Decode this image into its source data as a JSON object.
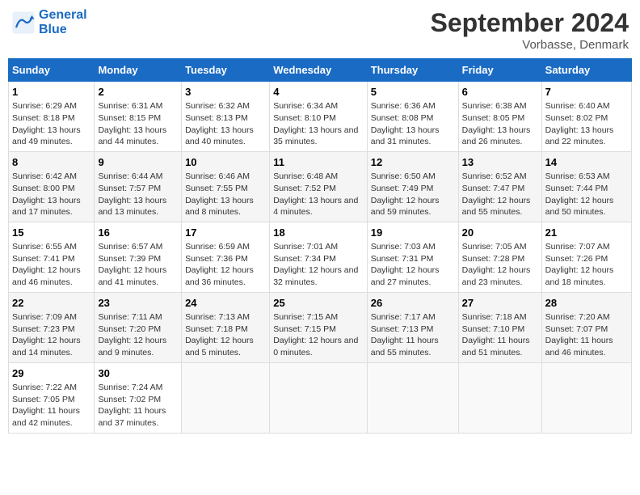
{
  "header": {
    "logo_line1": "General",
    "logo_line2": "Blue",
    "main_title": "September 2024",
    "subtitle": "Vorbasse, Denmark"
  },
  "days_of_week": [
    "Sunday",
    "Monday",
    "Tuesday",
    "Wednesday",
    "Thursday",
    "Friday",
    "Saturday"
  ],
  "weeks": [
    [
      {
        "day": "1",
        "sunrise": "Sunrise: 6:29 AM",
        "sunset": "Sunset: 8:18 PM",
        "daylight": "Daylight: 13 hours and 49 minutes."
      },
      {
        "day": "2",
        "sunrise": "Sunrise: 6:31 AM",
        "sunset": "Sunset: 8:15 PM",
        "daylight": "Daylight: 13 hours and 44 minutes."
      },
      {
        "day": "3",
        "sunrise": "Sunrise: 6:32 AM",
        "sunset": "Sunset: 8:13 PM",
        "daylight": "Daylight: 13 hours and 40 minutes."
      },
      {
        "day": "4",
        "sunrise": "Sunrise: 6:34 AM",
        "sunset": "Sunset: 8:10 PM",
        "daylight": "Daylight: 13 hours and 35 minutes."
      },
      {
        "day": "5",
        "sunrise": "Sunrise: 6:36 AM",
        "sunset": "Sunset: 8:08 PM",
        "daylight": "Daylight: 13 hours and 31 minutes."
      },
      {
        "day": "6",
        "sunrise": "Sunrise: 6:38 AM",
        "sunset": "Sunset: 8:05 PM",
        "daylight": "Daylight: 13 hours and 26 minutes."
      },
      {
        "day": "7",
        "sunrise": "Sunrise: 6:40 AM",
        "sunset": "Sunset: 8:02 PM",
        "daylight": "Daylight: 13 hours and 22 minutes."
      }
    ],
    [
      {
        "day": "8",
        "sunrise": "Sunrise: 6:42 AM",
        "sunset": "Sunset: 8:00 PM",
        "daylight": "Daylight: 13 hours and 17 minutes."
      },
      {
        "day": "9",
        "sunrise": "Sunrise: 6:44 AM",
        "sunset": "Sunset: 7:57 PM",
        "daylight": "Daylight: 13 hours and 13 minutes."
      },
      {
        "day": "10",
        "sunrise": "Sunrise: 6:46 AM",
        "sunset": "Sunset: 7:55 PM",
        "daylight": "Daylight: 13 hours and 8 minutes."
      },
      {
        "day": "11",
        "sunrise": "Sunrise: 6:48 AM",
        "sunset": "Sunset: 7:52 PM",
        "daylight": "Daylight: 13 hours and 4 minutes."
      },
      {
        "day": "12",
        "sunrise": "Sunrise: 6:50 AM",
        "sunset": "Sunset: 7:49 PM",
        "daylight": "Daylight: 12 hours and 59 minutes."
      },
      {
        "day": "13",
        "sunrise": "Sunrise: 6:52 AM",
        "sunset": "Sunset: 7:47 PM",
        "daylight": "Daylight: 12 hours and 55 minutes."
      },
      {
        "day": "14",
        "sunrise": "Sunrise: 6:53 AM",
        "sunset": "Sunset: 7:44 PM",
        "daylight": "Daylight: 12 hours and 50 minutes."
      }
    ],
    [
      {
        "day": "15",
        "sunrise": "Sunrise: 6:55 AM",
        "sunset": "Sunset: 7:41 PM",
        "daylight": "Daylight: 12 hours and 46 minutes."
      },
      {
        "day": "16",
        "sunrise": "Sunrise: 6:57 AM",
        "sunset": "Sunset: 7:39 PM",
        "daylight": "Daylight: 12 hours and 41 minutes."
      },
      {
        "day": "17",
        "sunrise": "Sunrise: 6:59 AM",
        "sunset": "Sunset: 7:36 PM",
        "daylight": "Daylight: 12 hours and 36 minutes."
      },
      {
        "day": "18",
        "sunrise": "Sunrise: 7:01 AM",
        "sunset": "Sunset: 7:34 PM",
        "daylight": "Daylight: 12 hours and 32 minutes."
      },
      {
        "day": "19",
        "sunrise": "Sunrise: 7:03 AM",
        "sunset": "Sunset: 7:31 PM",
        "daylight": "Daylight: 12 hours and 27 minutes."
      },
      {
        "day": "20",
        "sunrise": "Sunrise: 7:05 AM",
        "sunset": "Sunset: 7:28 PM",
        "daylight": "Daylight: 12 hours and 23 minutes."
      },
      {
        "day": "21",
        "sunrise": "Sunrise: 7:07 AM",
        "sunset": "Sunset: 7:26 PM",
        "daylight": "Daylight: 12 hours and 18 minutes."
      }
    ],
    [
      {
        "day": "22",
        "sunrise": "Sunrise: 7:09 AM",
        "sunset": "Sunset: 7:23 PM",
        "daylight": "Daylight: 12 hours and 14 minutes."
      },
      {
        "day": "23",
        "sunrise": "Sunrise: 7:11 AM",
        "sunset": "Sunset: 7:20 PM",
        "daylight": "Daylight: 12 hours and 9 minutes."
      },
      {
        "day": "24",
        "sunrise": "Sunrise: 7:13 AM",
        "sunset": "Sunset: 7:18 PM",
        "daylight": "Daylight: 12 hours and 5 minutes."
      },
      {
        "day": "25",
        "sunrise": "Sunrise: 7:15 AM",
        "sunset": "Sunset: 7:15 PM",
        "daylight": "Daylight: 12 hours and 0 minutes."
      },
      {
        "day": "26",
        "sunrise": "Sunrise: 7:17 AM",
        "sunset": "Sunset: 7:13 PM",
        "daylight": "Daylight: 11 hours and 55 minutes."
      },
      {
        "day": "27",
        "sunrise": "Sunrise: 7:18 AM",
        "sunset": "Sunset: 7:10 PM",
        "daylight": "Daylight: 11 hours and 51 minutes."
      },
      {
        "day": "28",
        "sunrise": "Sunrise: 7:20 AM",
        "sunset": "Sunset: 7:07 PM",
        "daylight": "Daylight: 11 hours and 46 minutes."
      }
    ],
    [
      {
        "day": "29",
        "sunrise": "Sunrise: 7:22 AM",
        "sunset": "Sunset: 7:05 PM",
        "daylight": "Daylight: 11 hours and 42 minutes."
      },
      {
        "day": "30",
        "sunrise": "Sunrise: 7:24 AM",
        "sunset": "Sunset: 7:02 PM",
        "daylight": "Daylight: 11 hours and 37 minutes."
      },
      null,
      null,
      null,
      null,
      null
    ]
  ]
}
